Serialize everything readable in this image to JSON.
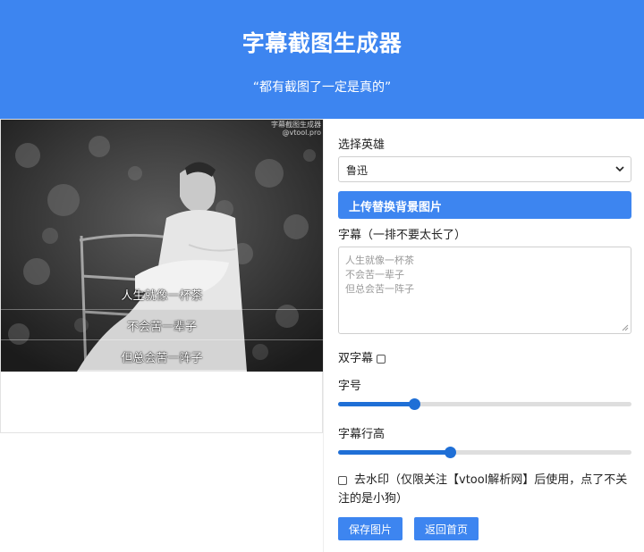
{
  "header": {
    "title": "字幕截图生成器",
    "subtitle": "“都有截图了一定是真的”"
  },
  "preview": {
    "watermark_line1": "字幕截图生成器",
    "watermark_line2": "@vtool.pro",
    "subtitle_lines": [
      "人生就像一杯茶",
      "不会苦一辈子",
      "但总会苦一阵子"
    ]
  },
  "form": {
    "hero_label": "选择英雄",
    "hero_selected": "鲁迅",
    "upload_label": "上传替换背景图片",
    "caption_label": "字幕（一排不要太长了）",
    "caption_placeholder_lines": [
      "人生就像一杯茶",
      "不会苦一辈子",
      "但总会苦一阵子"
    ],
    "double_caption_label": "双字幕",
    "double_caption_checked": false,
    "font_size_label": "字号",
    "font_size_value": 0.26,
    "line_height_label": "字幕行高",
    "line_height_value": 0.38,
    "remove_watermark_label": "去水印（仅限关注【vtool解析网】后使用，点了不关注的是小狗）",
    "remove_watermark_checked": false,
    "save_button": "保存图片",
    "home_button": "返回首页"
  },
  "colors": {
    "primary": "#3d85f0",
    "slider": "#1f6fd6"
  }
}
